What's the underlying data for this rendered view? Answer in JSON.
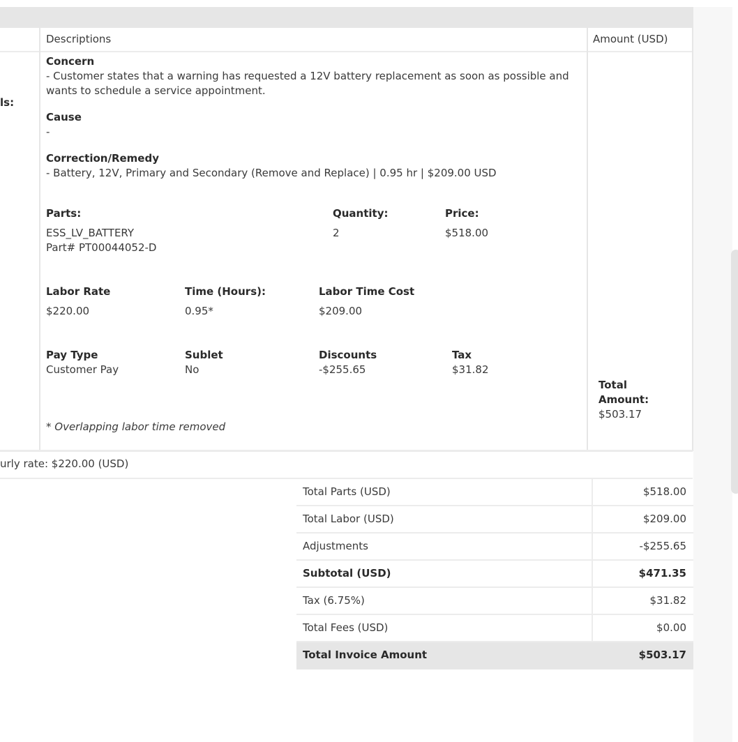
{
  "table_header": {
    "descriptions": "Descriptions",
    "amount": "Amount (USD)"
  },
  "left_cut_label": "ls:",
  "concern": {
    "heading": "Concern",
    "text": "- Customer states that a warning has requested a 12V battery replacement as soon as possible and wants to schedule a service appointment."
  },
  "cause": {
    "heading": "Cause",
    "text": "-"
  },
  "correction": {
    "heading": "Correction/Remedy",
    "text": "- Battery, 12V, Primary and Secondary (Remove and Replace) | 0.95 hr | $209.00 USD"
  },
  "parts": {
    "heading": "Parts:",
    "quantity_heading": "Quantity:",
    "price_heading": "Price:",
    "part_name": "ESS_LV_BATTERY",
    "part_number": "Part# PT00044052-D",
    "quantity": "2",
    "price": "$518.00"
  },
  "labor": {
    "rate_heading": "Labor Rate",
    "rate": "$220.00",
    "time_heading": "Time (Hours):",
    "time": "0.95*",
    "cost_heading": "Labor Time Cost",
    "cost": "$209.00"
  },
  "pay": {
    "type_heading": "Pay Type",
    "type": "Customer Pay",
    "sublet_heading": "Sublet",
    "sublet": "No",
    "discounts_heading": "Discounts",
    "discounts": "-$255.65",
    "tax_heading": "Tax",
    "tax": "$31.82"
  },
  "note": "* Overlapping labor time removed",
  "line_total": {
    "label_1": "Total",
    "label_2": "Amount:",
    "value": "$503.17"
  },
  "hourly_rate": "urly rate: $220.00 (USD)",
  "totals": [
    {
      "label": "Total Parts (USD)",
      "value": "$518.00",
      "bold": false
    },
    {
      "label": "Total Labor (USD)",
      "value": "$209.00",
      "bold": false
    },
    {
      "label": "Adjustments",
      "value": "-$255.65",
      "bold": false
    },
    {
      "label": "Subtotal (USD)",
      "value": "$471.35",
      "bold": true
    },
    {
      "label": "Tax (6.75%)",
      "value": "$31.82",
      "bold": false
    },
    {
      "label": "Total Fees (USD)",
      "value": "$0.00",
      "bold": false
    },
    {
      "label": "Total Invoice Amount",
      "value": "$503.17",
      "bold": true
    }
  ]
}
